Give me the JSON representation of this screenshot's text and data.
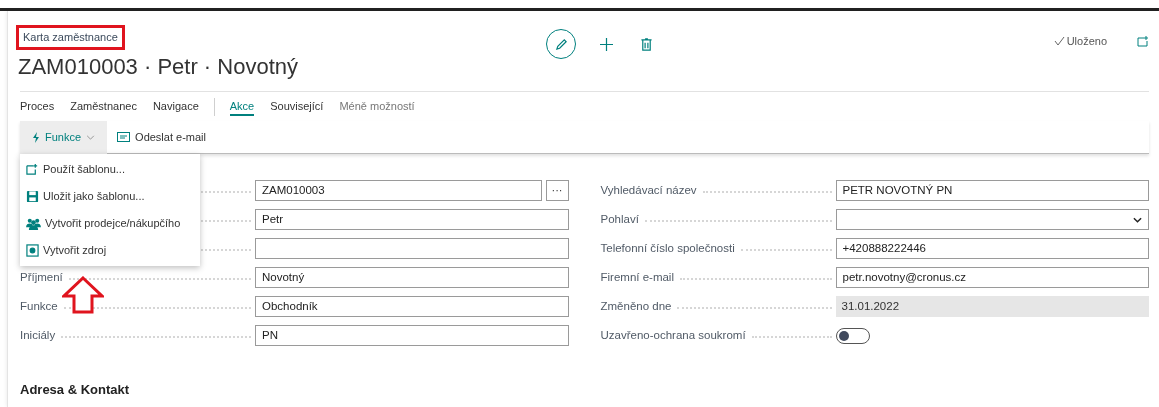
{
  "header": {
    "breadcrumb": "Karta zaměstnance",
    "title": "ZAM010003 · Petr · Novotný",
    "status": "Uloženo"
  },
  "tab_groups": [
    {
      "tabs": [
        {
          "label": "Proces",
          "selected": false
        },
        {
          "label": "Zaměstnanec",
          "selected": false
        },
        {
          "label": "Navigace",
          "selected": false
        }
      ]
    },
    {
      "tabs": [
        {
          "label": "Akce",
          "selected": true
        },
        {
          "label": "Související",
          "selected": false
        }
      ],
      "more": "Méně možností"
    }
  ],
  "actions": {
    "functions": {
      "label": "Funkce",
      "expanded": true
    },
    "email": "Odeslat e-mail"
  },
  "menu": [
    {
      "label": "Použít šablonu..."
    },
    {
      "label": "Uložit jako šablonu..."
    },
    {
      "label": "Vytvořit prodejce/nákupčího"
    },
    {
      "label": "Vytvořit zdroj"
    }
  ],
  "left_fields": [
    {
      "kind": "lookup",
      "value": "ZAM010003",
      "assist": "···"
    },
    {
      "kind": "text",
      "value": "Petr"
    },
    {
      "kind": "text"
    },
    {
      "kind": "text",
      "label": "Příjmení",
      "value": "Novotný"
    },
    {
      "kind": "text",
      "label": "Funkce",
      "value": "Obchodník"
    },
    {
      "kind": "text",
      "label": "Iniciály",
      "value": "PN"
    }
  ],
  "right_fields": [
    {
      "kind": "text",
      "label": "Vyhledávací název",
      "value": "PETR NOVOTNÝ PN"
    },
    {
      "kind": "select",
      "label": "Pohlaví"
    },
    {
      "kind": "text",
      "label": "Telefonní číslo společnosti",
      "value": "+420888222446"
    },
    {
      "kind": "text",
      "label": "Firemní e-mail",
      "value": "petr.novotny@cronus.cz"
    },
    {
      "kind": "readonly",
      "label": "Změněno dne",
      "value": "31.01.2022"
    },
    {
      "kind": "toggle",
      "label": "Uzavřeno-ochrana soukromí",
      "on": false
    }
  ],
  "section": "Adresa & Kontakt"
}
